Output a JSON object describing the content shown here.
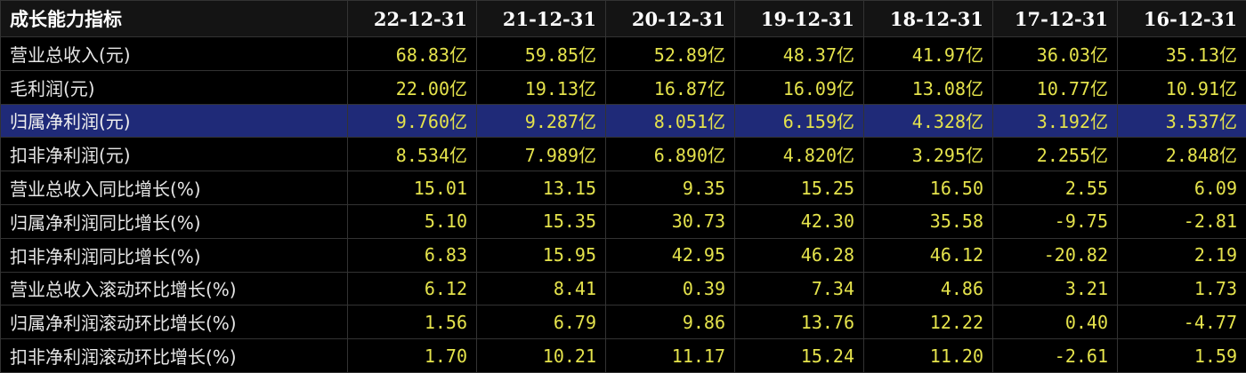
{
  "table": {
    "header_label": "成长能力指标",
    "columns": [
      "22-12-31",
      "21-12-31",
      "20-12-31",
      "19-12-31",
      "18-12-31",
      "17-12-31",
      "16-12-31"
    ],
    "rows": [
      {
        "label": "营业总收入(元)",
        "values": [
          "68.83亿",
          "59.85亿",
          "52.89亿",
          "48.37亿",
          "41.97亿",
          "36.03亿",
          "35.13亿"
        ]
      },
      {
        "label": "毛利润(元)",
        "values": [
          "22.00亿",
          "19.13亿",
          "16.87亿",
          "16.09亿",
          "13.08亿",
          "10.77亿",
          "10.91亿"
        ]
      },
      {
        "label": "归属净利润(元)",
        "values": [
          "9.760亿",
          "9.287亿",
          "8.051亿",
          "6.159亿",
          "4.328亿",
          "3.192亿",
          "3.537亿"
        ]
      },
      {
        "label": "扣非净利润(元)",
        "values": [
          "8.534亿",
          "7.989亿",
          "6.890亿",
          "4.820亿",
          "3.295亿",
          "2.255亿",
          "2.848亿"
        ]
      },
      {
        "label": "营业总收入同比增长(%)",
        "values": [
          "15.01",
          "13.15",
          "9.35",
          "15.25",
          "16.50",
          "2.55",
          "6.09"
        ]
      },
      {
        "label": "归属净利润同比增长(%)",
        "values": [
          "5.10",
          "15.35",
          "30.73",
          "42.30",
          "35.58",
          "-9.75",
          "-2.81"
        ]
      },
      {
        "label": "扣非净利润同比增长(%)",
        "values": [
          "6.83",
          "15.95",
          "42.95",
          "46.28",
          "46.12",
          "-20.82",
          "2.19"
        ]
      },
      {
        "label": "营业总收入滚动环比增长(%)",
        "values": [
          "6.12",
          "8.41",
          "0.39",
          "7.34",
          "4.86",
          "3.21",
          "1.73"
        ]
      },
      {
        "label": "归属净利润滚动环比增长(%)",
        "values": [
          "1.56",
          "6.79",
          "9.86",
          "13.76",
          "12.22",
          "0.40",
          "-4.77"
        ]
      },
      {
        "label": "扣非净利润滚动环比增长(%)",
        "values": [
          "1.70",
          "10.21",
          "11.17",
          "15.24",
          "11.20",
          "-2.61",
          "1.59"
        ]
      }
    ],
    "selected_row": 2
  },
  "colors": {
    "background": "#000000",
    "value_text": "#e5e34c",
    "label_text": "#e6e6e6",
    "header_text": "#ffffff",
    "selected_row": "#1f2a78",
    "grid": "#333333"
  }
}
